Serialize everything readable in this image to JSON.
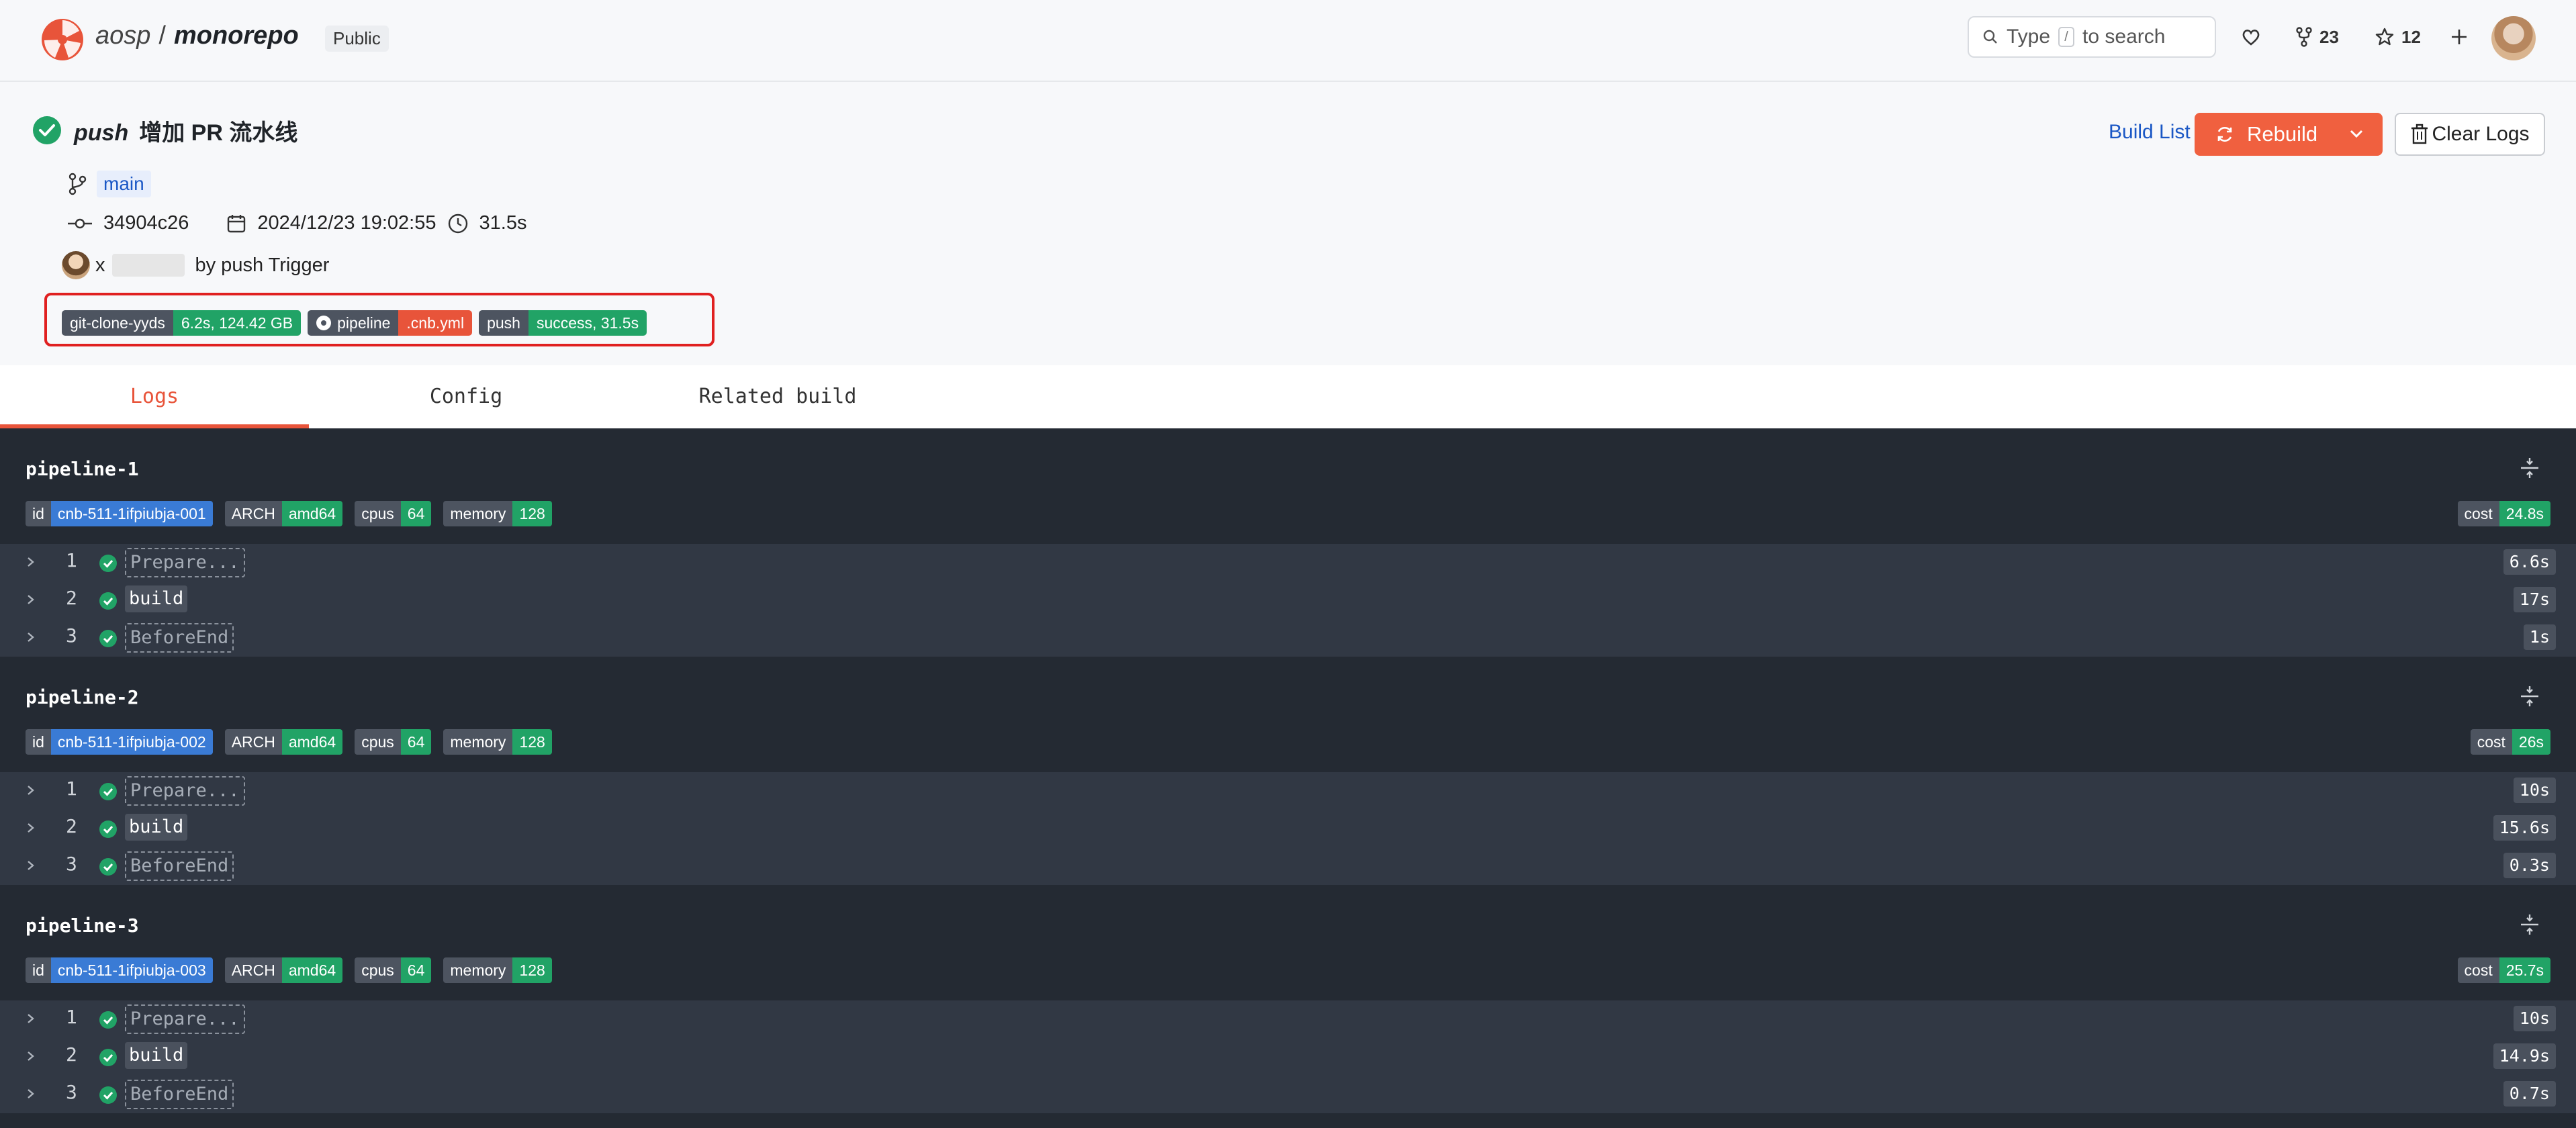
{
  "header": {
    "owner": "aosp",
    "separator": "/",
    "repo": "monorepo",
    "visibility": "Public",
    "search_prefix": "Type",
    "search_key": "/",
    "search_suffix": "to search",
    "fork_count": "23",
    "star_count": "12"
  },
  "build": {
    "event": "push",
    "title": "增加 PR 流水线",
    "branch": "main",
    "commit": "34904c26",
    "date": "2024/12/23 19:02:55",
    "duration": "31.5s",
    "user_prefix": "x",
    "trigger_text": "by push Trigger",
    "badges": [
      {
        "key": "git-clone-yyds",
        "value": "6.2s, 124.42 GB"
      },
      {
        "key": "pipeline",
        "value": ".cnb.yml"
      },
      {
        "key": "push",
        "value": "success, 31.5s"
      }
    ]
  },
  "actions": {
    "build_list": "Build List",
    "rebuild": "Rebuild",
    "clear_logs": "Clear Logs"
  },
  "tabs": [
    "Logs",
    "Config",
    "Related build"
  ],
  "pipelines": [
    {
      "name": "pipeline-1",
      "id": "cnb-511-1ifpiubja-001",
      "arch": "amd64",
      "cpus": "64",
      "memory": "128",
      "cost": "24.8s",
      "steps": [
        {
          "num": "1",
          "name": "Prepare...",
          "duration": "6.6s"
        },
        {
          "num": "2",
          "name": "build",
          "duration": "17s"
        },
        {
          "num": "3",
          "name": "BeforeEnd",
          "duration": "1s"
        }
      ]
    },
    {
      "name": "pipeline-2",
      "id": "cnb-511-1ifpiubja-002",
      "arch": "amd64",
      "cpus": "64",
      "memory": "128",
      "cost": "26s",
      "steps": [
        {
          "num": "1",
          "name": "Prepare...",
          "duration": "10s"
        },
        {
          "num": "2",
          "name": "build",
          "duration": "15.6s"
        },
        {
          "num": "3",
          "name": "BeforeEnd",
          "duration": "0.3s"
        }
      ]
    },
    {
      "name": "pipeline-3",
      "id": "cnb-511-1ifpiubja-003",
      "arch": "amd64",
      "cpus": "64",
      "memory": "128",
      "cost": "25.7s",
      "steps": [
        {
          "num": "1",
          "name": "Prepare...",
          "duration": "10s"
        },
        {
          "num": "2",
          "name": "build",
          "duration": "14.9s"
        },
        {
          "num": "3",
          "name": "BeforeEnd",
          "duration": "0.7s"
        }
      ]
    }
  ],
  "labels": {
    "id": "id",
    "arch": "ARCH",
    "cpus": "cpus",
    "memory": "memory",
    "cost": "cost"
  },
  "colors": {
    "accent": "#e8543a",
    "success": "#21a366",
    "link": "#1a57c5",
    "log_bg": "#242a33"
  }
}
